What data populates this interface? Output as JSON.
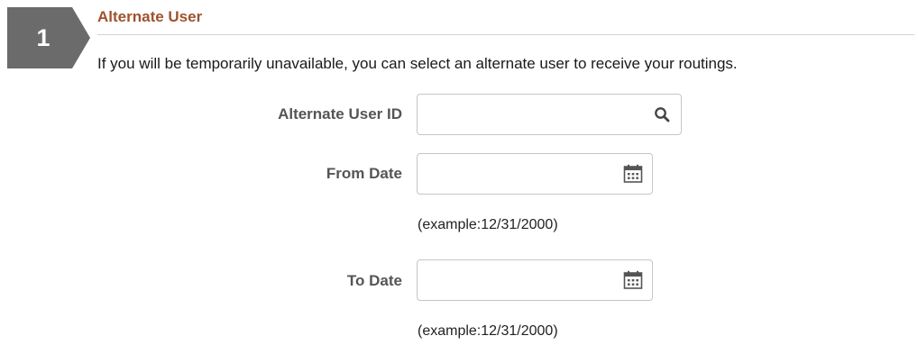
{
  "step": {
    "number": "1",
    "color": "#6b6b6b"
  },
  "section": {
    "title": "Alternate User",
    "title_color": "#a0522d",
    "instructions": "If you will be temporarily unavailable, you can select an alternate user to receive your routings."
  },
  "fields": {
    "alternate_user_id": {
      "label": "Alternate User ID",
      "value": "",
      "icon": "search-icon"
    },
    "from_date": {
      "label": "From Date",
      "value": "",
      "icon": "calendar-icon",
      "hint": "(example:12/31/2000)"
    },
    "to_date": {
      "label": "To Date",
      "value": "",
      "icon": "calendar-icon",
      "hint": "(example:12/31/2000)"
    }
  }
}
